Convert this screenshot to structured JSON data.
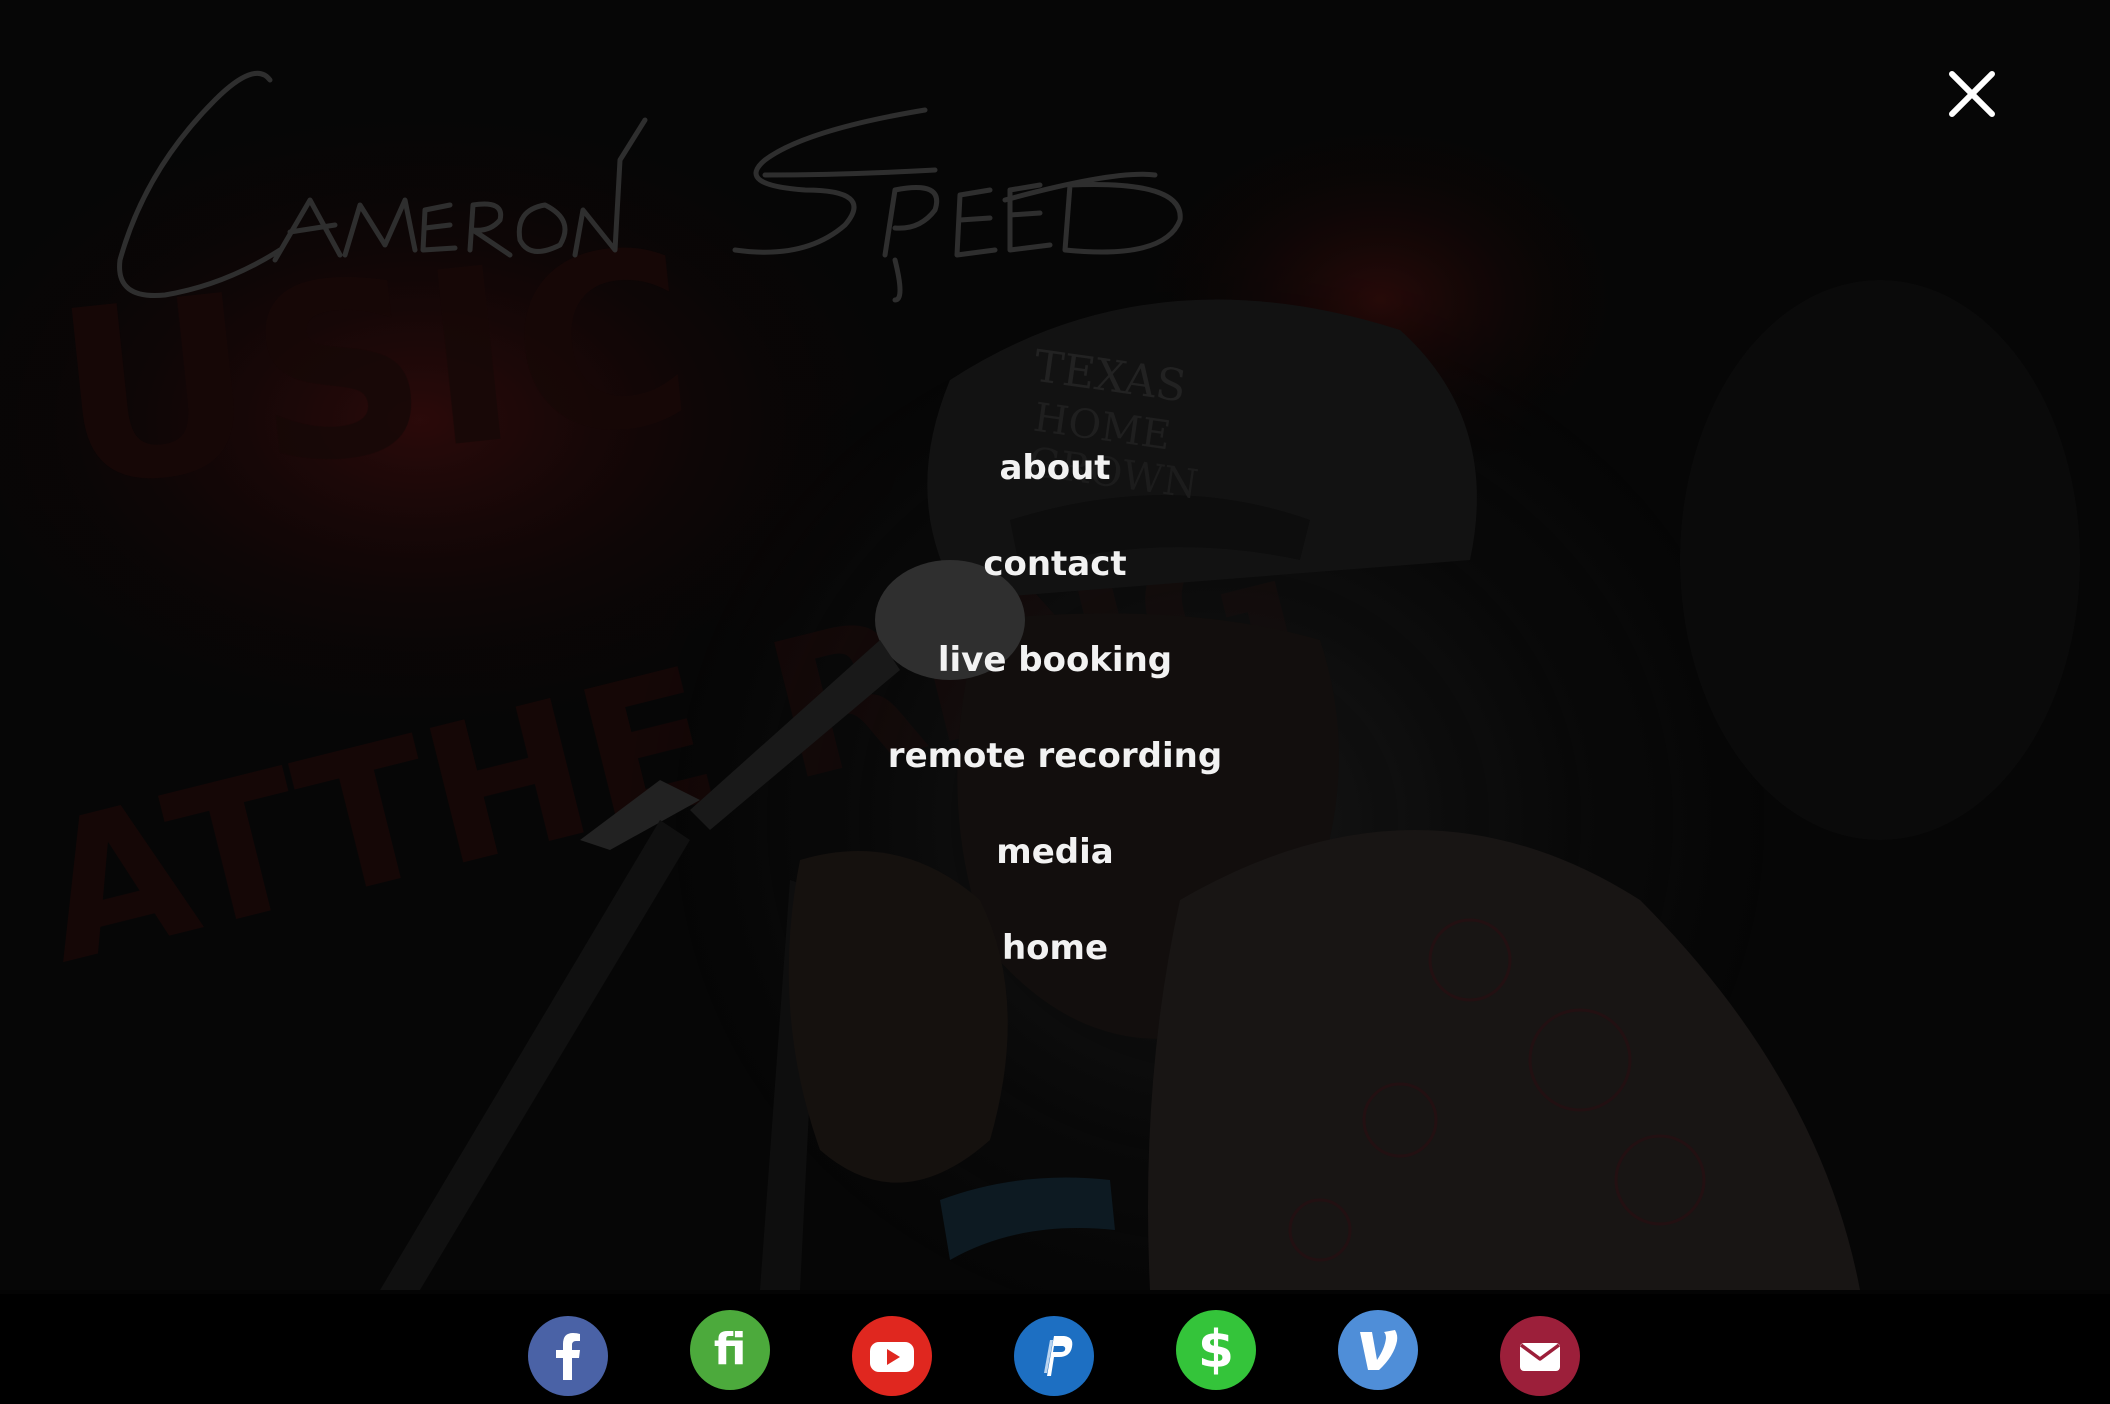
{
  "header": {
    "signature_text": "Cameron Speed",
    "close_icon": "close-icon"
  },
  "menu": {
    "items": [
      {
        "label": "about"
      },
      {
        "label": "contact"
      },
      {
        "label": "live booking"
      },
      {
        "label": "remote recording"
      },
      {
        "label": "media"
      },
      {
        "label": "home"
      }
    ]
  },
  "social": {
    "items": [
      {
        "icon": "facebook-icon",
        "color": "#4a62a6"
      },
      {
        "icon": "fi-icon",
        "color": "#4caa3c"
      },
      {
        "icon": "youtube-icon",
        "color": "#e0271f"
      },
      {
        "icon": "paypal-icon",
        "color": "#1d6fc2"
      },
      {
        "icon": "cash-app-icon",
        "color": "#34c43a"
      },
      {
        "icon": "venmo-icon",
        "color": "#4f8ed8"
      },
      {
        "icon": "email-icon",
        "color": "#9c1f3a"
      }
    ]
  },
  "colors": {
    "background": "#050505",
    "menu_text": "#f2f2f2",
    "signature": "#2c2c2c"
  }
}
